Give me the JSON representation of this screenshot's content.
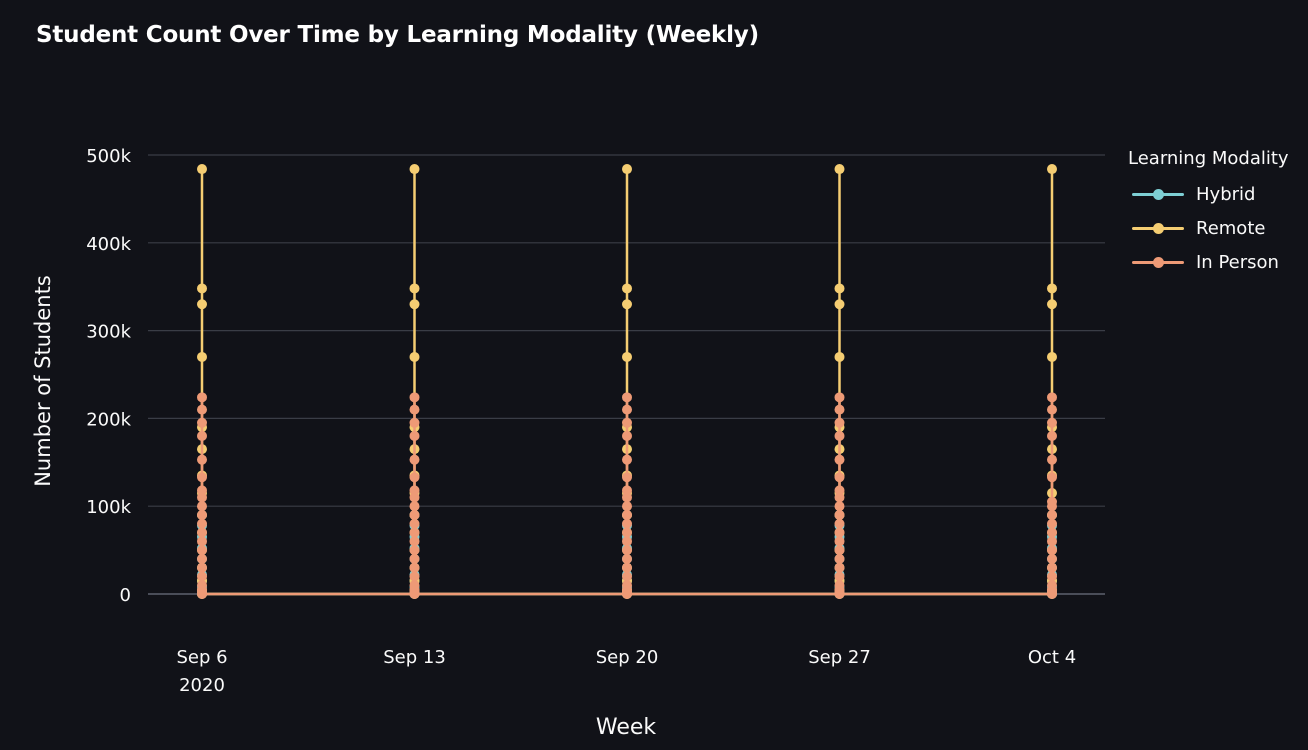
{
  "title": "Student Count Over Time by Learning Modality (Weekly)",
  "colors": {
    "background": "#111218",
    "grid": "#3a3d46",
    "zero_line": "#4a4d58",
    "Hybrid": "#7ecfd4",
    "Remote": "#f5cd72",
    "In Person": "#ee9a76"
  },
  "legend": {
    "title": "Learning Modality",
    "items": [
      {
        "name": "Hybrid",
        "color": "#7ecfd4"
      },
      {
        "name": "Remote",
        "color": "#f5cd72"
      },
      {
        "name": "In Person",
        "color": "#ee9a76"
      }
    ]
  },
  "chart_data": {
    "type": "line",
    "title": "Student Count Over Time by Learning Modality (Weekly)",
    "xlabel": "Week",
    "ylabel": "Number of Students",
    "x": [
      "2020-09-06",
      "2020-09-13",
      "2020-09-20",
      "2020-09-27",
      "2020-10-04"
    ],
    "x_tick_labels": [
      "Sep 6",
      "Sep 13",
      "Sep 20",
      "Sep 27",
      "Oct 4"
    ],
    "x_tick_sublabel": "2020",
    "y_ticks": [
      0,
      100000,
      200000,
      300000,
      400000,
      500000
    ],
    "y_tick_labels": [
      "0",
      "100k",
      "200k",
      "300k",
      "400k",
      "500k"
    ],
    "ylim": [
      -30000,
      520000
    ],
    "grid": true,
    "legend_position": "right",
    "series": [
      {
        "name": "Hybrid",
        "color": "#7ecfd4",
        "values_per_week": [
          [
            0,
            1000,
            3000,
            8000,
            15000,
            22000,
            30000,
            40000,
            52000,
            65000,
            78000,
            90000
          ],
          [
            0,
            1000,
            3000,
            8000,
            15000,
            22000,
            30000,
            40000,
            52000,
            65000,
            78000,
            90000
          ],
          [
            0,
            1000,
            3000,
            8000,
            15000,
            22000,
            30000,
            40000,
            52000,
            65000,
            78000,
            90000
          ],
          [
            0,
            1000,
            3000,
            8000,
            15000,
            22000,
            30000,
            40000,
            52000,
            65000,
            78000,
            90000
          ],
          [
            0,
            1000,
            3000,
            8000,
            15000,
            22000,
            30000,
            40000,
            52000,
            65000,
            78000,
            90000
          ]
        ]
      },
      {
        "name": "Remote",
        "color": "#f5cd72",
        "values_per_week": [
          [
            0,
            5000,
            15000,
            30000,
            50000,
            70000,
            90000,
            115000,
            135000,
            165000,
            190000,
            270000,
            330000,
            348000,
            484000
          ],
          [
            0,
            5000,
            15000,
            30000,
            50000,
            70000,
            90000,
            115000,
            135000,
            165000,
            190000,
            270000,
            330000,
            348000,
            484000
          ],
          [
            0,
            5000,
            15000,
            30000,
            50000,
            70000,
            90000,
            115000,
            135000,
            165000,
            190000,
            270000,
            330000,
            348000,
            484000
          ],
          [
            0,
            5000,
            15000,
            30000,
            50000,
            70000,
            90000,
            115000,
            135000,
            165000,
            190000,
            270000,
            330000,
            348000,
            484000
          ],
          [
            0,
            5000,
            15000,
            30000,
            50000,
            70000,
            90000,
            115000,
            135000,
            165000,
            190000,
            270000,
            330000,
            348000,
            484000
          ]
        ]
      },
      {
        "name": "In Person",
        "color": "#ee9a76",
        "values_per_week": [
          [
            0,
            2000,
            5000,
            10000,
            20000,
            30000,
            40000,
            50000,
            60000,
            70000,
            80000,
            90000,
            100000,
            110000,
            118000,
            133000,
            153000,
            180000,
            195000,
            210000,
            224000
          ],
          [
            0,
            2000,
            5000,
            10000,
            20000,
            30000,
            40000,
            50000,
            60000,
            70000,
            80000,
            90000,
            100000,
            110000,
            118000,
            133000,
            153000,
            180000,
            195000,
            210000,
            224000
          ],
          [
            0,
            2000,
            5000,
            10000,
            20000,
            30000,
            40000,
            50000,
            60000,
            70000,
            80000,
            90000,
            100000,
            110000,
            118000,
            133000,
            153000,
            180000,
            195000,
            210000,
            224000
          ],
          [
            0,
            2000,
            5000,
            10000,
            20000,
            30000,
            40000,
            50000,
            60000,
            70000,
            80000,
            90000,
            100000,
            110000,
            118000,
            133000,
            153000,
            180000,
            195000,
            210000,
            224000
          ],
          [
            0,
            2000,
            5000,
            10000,
            20000,
            30000,
            40000,
            50000,
            60000,
            70000,
            80000,
            90000,
            100000,
            105000,
            133000,
            153000,
            180000,
            195000,
            210000,
            224000
          ]
        ]
      }
    ]
  }
}
